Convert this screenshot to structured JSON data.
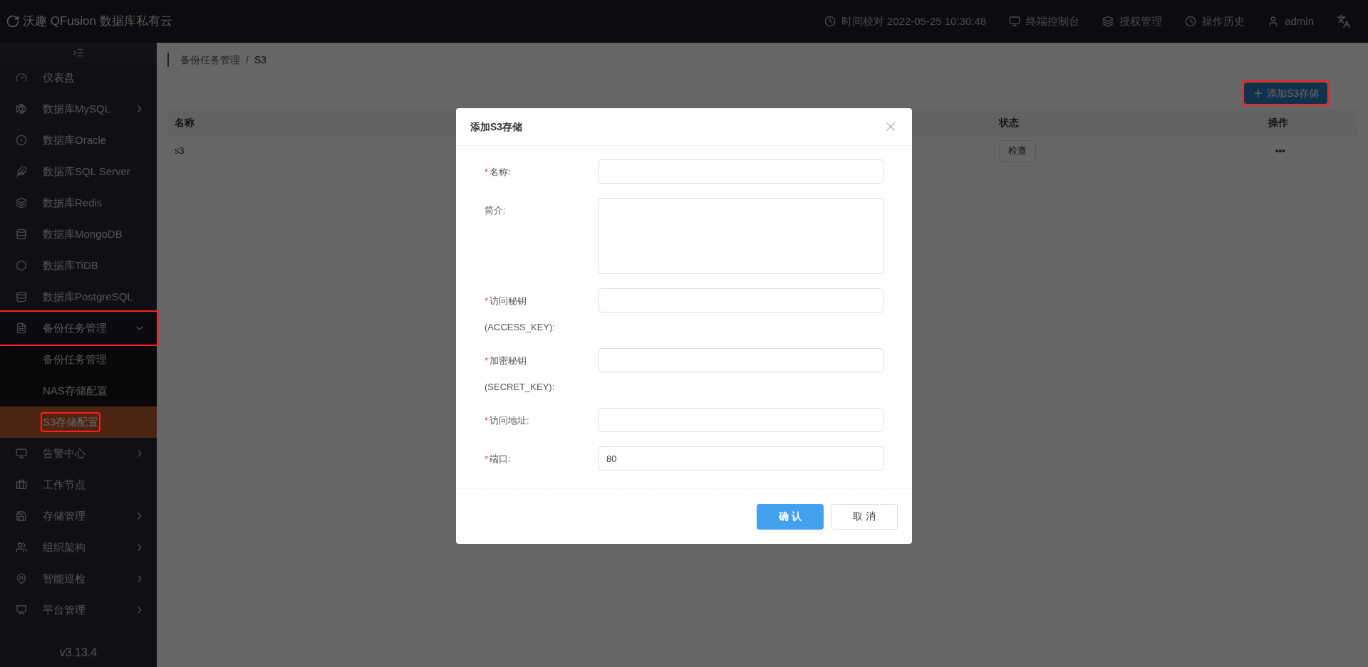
{
  "topbar": {
    "brand": "沃趣 QFusion 数据库私有云",
    "items": [
      {
        "kind": "clock",
        "label": "时间校对 2022-05-25 10:30:48"
      },
      {
        "kind": "monitor",
        "label": "终端控制台"
      },
      {
        "kind": "layers",
        "label": "授权管理"
      },
      {
        "kind": "history",
        "label": "操作历史"
      },
      {
        "kind": "user",
        "label": "admin"
      }
    ]
  },
  "sidebar": {
    "items": [
      {
        "kind": "link",
        "label": "仪表盘",
        "selected": false,
        "annotated": false
      },
      {
        "kind": "submenu",
        "label": "数据库MySQL",
        "expanded": false,
        "selected": false,
        "annotated": false
      },
      {
        "kind": "link",
        "label": "数据库Oracle",
        "selected": false,
        "annotated": false
      },
      {
        "kind": "link",
        "label": "数据库SQL Server",
        "selected": false,
        "annotated": false
      },
      {
        "kind": "link",
        "label": "数据库Redis",
        "selected": false,
        "annotated": false
      },
      {
        "kind": "link",
        "label": "数据库MongoDB",
        "selected": false,
        "annotated": false
      },
      {
        "kind": "link",
        "label": "数据库TiDB",
        "selected": false,
        "annotated": false
      },
      {
        "kind": "link",
        "label": "数据库PostgreSQL",
        "selected": false,
        "annotated": false
      },
      {
        "kind": "submenu",
        "label": "备份任务管理",
        "expanded": true,
        "selected": false,
        "annotated": true,
        "children": [
          {
            "label": "备份任务管理",
            "selected": false,
            "annotated": false
          },
          {
            "label": "NAS存储配置",
            "selected": false,
            "annotated": false
          },
          {
            "label": "S3存储配置",
            "selected": true,
            "annotated": true
          }
        ]
      },
      {
        "kind": "submenu",
        "label": "告警中心",
        "expanded": false,
        "selected": false,
        "annotated": false
      },
      {
        "kind": "link",
        "label": "工作节点",
        "selected": false,
        "annotated": false
      },
      {
        "kind": "submenu",
        "label": "存储管理",
        "expanded": false,
        "selected": false,
        "annotated": false
      },
      {
        "kind": "submenu",
        "label": "组织架构",
        "expanded": false,
        "selected": false,
        "annotated": false
      },
      {
        "kind": "submenu",
        "label": "智能巡检",
        "expanded": false,
        "selected": false,
        "annotated": false
      },
      {
        "kind": "submenu",
        "label": "平台管理",
        "expanded": false,
        "selected": false,
        "annotated": false
      }
    ],
    "version": "v3.13.4"
  },
  "breadcrumb": [
    "备份任务管理",
    "/",
    "S3"
  ],
  "add_button": {
    "label": "添加S3存储",
    "annotated": true
  },
  "table": {
    "columns": [
      "名称",
      "状态",
      "操作"
    ],
    "rows": [
      {
        "name": "s3",
        "check": "检查",
        "actions": "•••"
      }
    ]
  },
  "dialog": {
    "title": "添加S3存储",
    "fields": [
      {
        "kind": "input",
        "required_mark": "*",
        "label": "名称:"
      },
      {
        "kind": "textarea",
        "label": "简介:"
      },
      {
        "kind": "input",
        "required_mark": "*",
        "label": "访问秘钥",
        "label_2": "(ACCESS_KEY):"
      },
      {
        "kind": "input",
        "required_mark": "*",
        "label": "加密秘钥",
        "label_2": "(SECRET_KEY):"
      },
      {
        "kind": "input",
        "required_mark": "*",
        "label": "访问地址:"
      },
      {
        "kind": "input",
        "required_mark": "*",
        "label": "端口:",
        "value": "80"
      }
    ],
    "buttons": [
      {
        "label": "确 认",
        "primary": true
      },
      {
        "label": "取 消",
        "primary": false
      }
    ]
  }
}
